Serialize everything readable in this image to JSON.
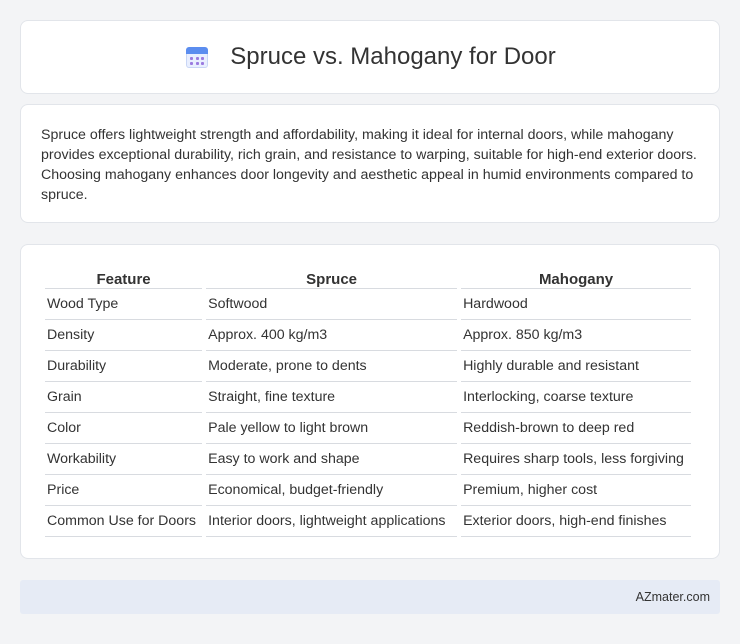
{
  "header": {
    "title": "Spruce vs. Mahogany for Door",
    "icon": "calendar-icon"
  },
  "summary": {
    "text": "Spruce offers lightweight strength and affordability, making it ideal for internal doors, while mahogany provides exceptional durability, rich grain, and resistance to warping, suitable for high-end exterior doors. Choosing mahogany enhances door longevity and aesthetic appeal in humid environments compared to spruce."
  },
  "table": {
    "headers": [
      "Feature",
      "Spruce",
      "Mahogany"
    ],
    "rows": [
      [
        "Wood Type",
        "Softwood",
        "Hardwood"
      ],
      [
        "Density",
        "Approx. 400 kg/m3",
        "Approx. 850 kg/m3"
      ],
      [
        "Durability",
        "Moderate, prone to dents",
        "Highly durable and resistant"
      ],
      [
        "Grain",
        "Straight, fine texture",
        "Interlocking, coarse texture"
      ],
      [
        "Color",
        "Pale yellow to light brown",
        "Reddish-brown to deep red"
      ],
      [
        "Workability",
        "Easy to work and shape",
        "Requires sharp tools, less forgiving"
      ],
      [
        "Price",
        "Economical, budget-friendly",
        "Premium, higher cost"
      ],
      [
        "Common Use for Doors",
        "Interior doors, lightweight applications",
        "Exterior doors, high-end finishes"
      ]
    ]
  },
  "footer": {
    "text": "AZmater.com"
  }
}
